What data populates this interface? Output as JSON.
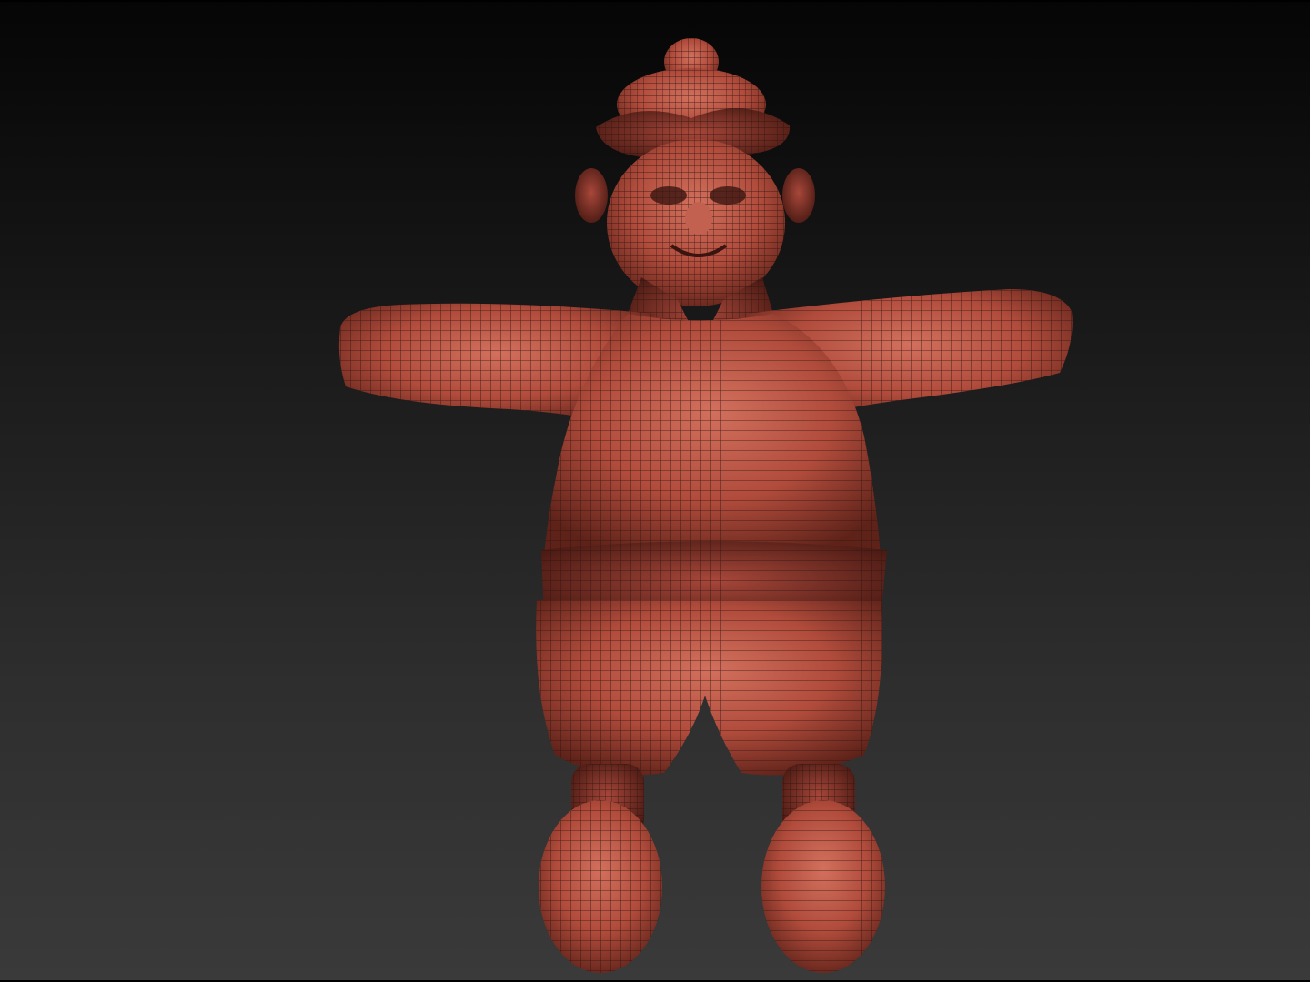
{
  "viewport": {
    "background_top": "#050505",
    "background_bottom": "#3a3a3a"
  },
  "model": {
    "material_color": "#b0483a",
    "wire_color": "#2a1410",
    "icon": "sculpted-character-mesh"
  }
}
